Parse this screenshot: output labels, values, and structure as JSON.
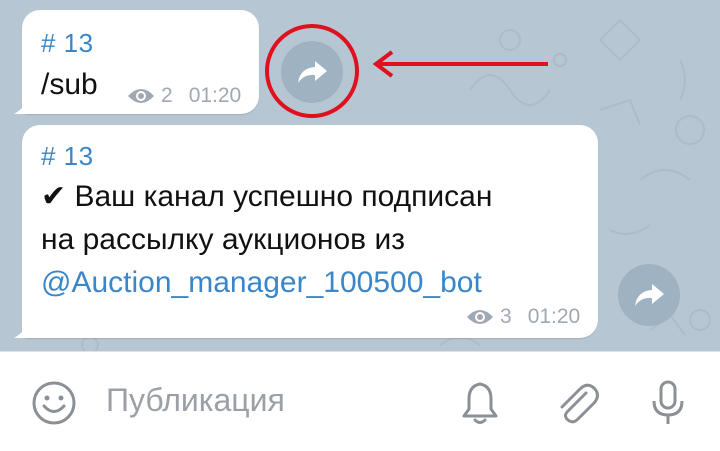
{
  "messages": [
    {
      "tag": "# 13",
      "text": "/sub",
      "views": "2",
      "time": "01:20"
    },
    {
      "tag": "# 13",
      "text_line1": "✔ Ваш канал успешно подписан",
      "text_line2": "на рассылку аукционов из",
      "link": "@Auction_manager_100500_bot",
      "views": "3",
      "time": "01:20"
    }
  ],
  "input": {
    "placeholder": "Публикация"
  },
  "icons": {
    "share": "share-arrow-icon",
    "views": "eye-icon",
    "emoji": "smile-icon",
    "bell": "bell-icon",
    "attach": "paperclip-icon",
    "mic": "microphone-icon"
  },
  "colors": {
    "chat_background": "#b6c6d3",
    "bubble": "#ffffff",
    "accent_link": "#3a86c6",
    "share_button": "#9fb2c2",
    "highlight": "#e0101e",
    "meta_text": "#a0a9b2"
  }
}
